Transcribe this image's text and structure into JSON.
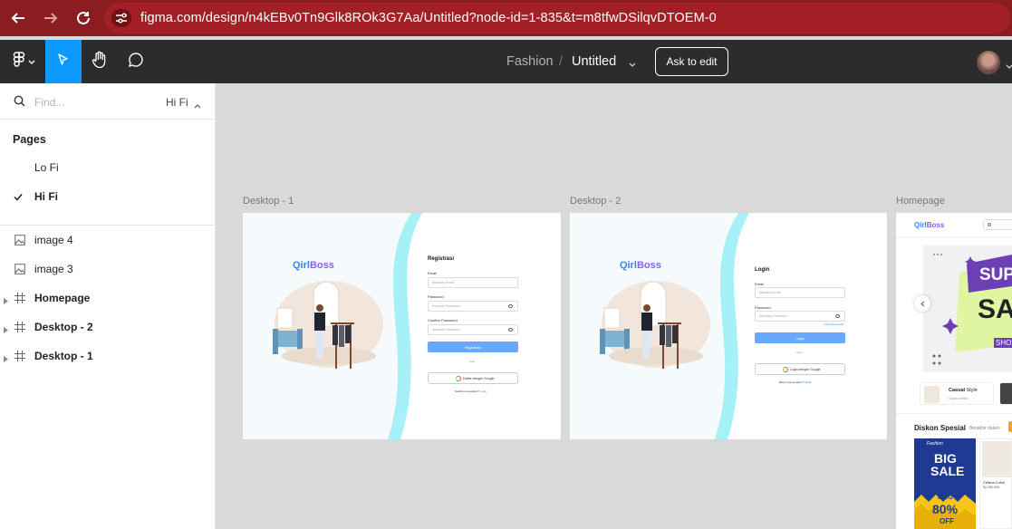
{
  "browser": {
    "url": "figma.com/design/n4kEBv0Tn9Glk8ROk3G7Aa/Untitled?node-id=1-835&t=m8tfwDSilqvDTOEM-0"
  },
  "toolbar": {
    "project": "Fashion",
    "separator": "/",
    "file": "Untitled",
    "ask_to_edit": "Ask to edit"
  },
  "left_panel": {
    "search_placeholder": "Find...",
    "current_page": "Hi Fi",
    "pages_heading": "Pages",
    "pages": [
      {
        "label": "Lo Fi",
        "checked": false
      },
      {
        "label": "Hi Fi",
        "checked": true
      }
    ],
    "layers": [
      {
        "label": "image 4",
        "type": "image"
      },
      {
        "label": "image 3",
        "type": "image"
      },
      {
        "label": "Homepage",
        "type": "frame"
      },
      {
        "label": "Desktop - 2",
        "type": "frame"
      },
      {
        "label": "Desktop - 1",
        "type": "frame"
      }
    ]
  },
  "canvas": {
    "frames": [
      {
        "label": "Desktop - 1",
        "logo_a": "Qirl",
        "logo_b": "Boss",
        "form_title": "Registrasi",
        "fields": [
          {
            "label": "Email",
            "placeholder": "Masukan Email"
          },
          {
            "label": "Password",
            "placeholder": "Masukan Password"
          },
          {
            "label": "Confirm Password",
            "placeholder": "Masukan Password"
          }
        ],
        "primary_button": "Registrasi",
        "divider": "Atau",
        "google_button": "Daftar dengan Google",
        "footer_text": "Sudah punya akun?",
        "footer_link": "Login"
      },
      {
        "label": "Desktop - 2",
        "logo_a": "Qirl",
        "logo_b": "Boss",
        "form_title": "Login",
        "fields": [
          {
            "label": "Email",
            "placeholder": "Masukan Email"
          },
          {
            "label": "Password",
            "placeholder": "Masukan Password"
          }
        ],
        "forgot": "Lupa Password?",
        "primary_button": "Login",
        "divider": "Atau",
        "google_button": "Login dengan Google",
        "footer_text": "Belum punya akun?",
        "footer_link": "Daftar"
      },
      {
        "label": "Homepage",
        "logo_a": "Qirl",
        "logo_b": "Boss",
        "banner_text_1": "SUP",
        "banner_text_2": "SA",
        "banner_text_3": "SHOP",
        "category_a": "Casual",
        "category_b": "Style",
        "category_sub": "Gaya santai",
        "section_title": "Diskon Spesial",
        "section_sub": "Berakhir dalam",
        "promo_brand": "Fashion",
        "promo_big": "BIG",
        "promo_sale": "SALE",
        "promo_upto": "UPTO",
        "promo_pct": "80%",
        "promo_off": "OFF",
        "product_name": "Celana Cullot",
        "product_price": "Rp 150.000"
      }
    ]
  },
  "colors": {
    "browser_bar": "#8b1c1f",
    "figma_toolbar": "#2c2c2c",
    "figma_accent": "#0d99ff",
    "brand_blue": "#3b82f6",
    "brand_yellow": "#f5c518",
    "form_button": "#6aa8ff",
    "wave_cyan": "#a6f0f7"
  }
}
